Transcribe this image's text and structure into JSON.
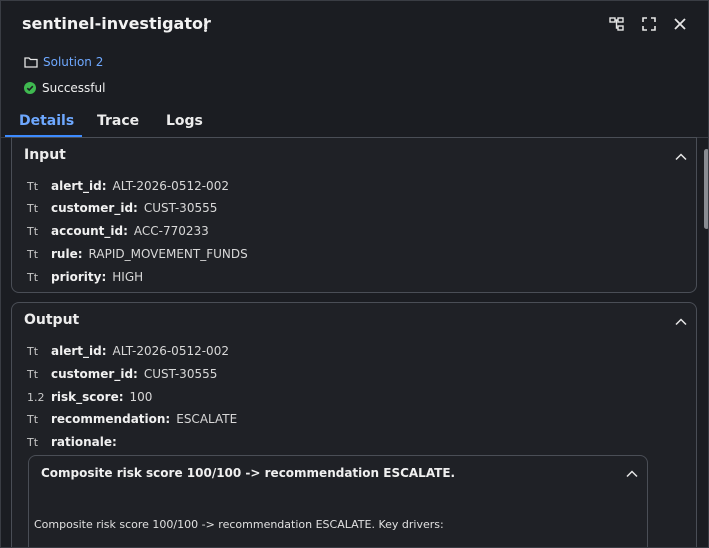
{
  "header": {
    "title": "sentinel-investigator"
  },
  "solution": {
    "label": "Solution 2"
  },
  "status": {
    "label": "Successful",
    "color": "#3fb950"
  },
  "tabs": [
    {
      "label": "Details",
      "active": true
    },
    {
      "label": "Trace",
      "active": false
    },
    {
      "label": "Logs",
      "active": false
    }
  ],
  "input": {
    "title": "Input",
    "fields": [
      {
        "type": "Tt",
        "key": "alert_id:",
        "value": "ALT-2026-0512-002"
      },
      {
        "type": "Tt",
        "key": "customer_id:",
        "value": "CUST-30555"
      },
      {
        "type": "Tt",
        "key": "account_id:",
        "value": "ACC-770233"
      },
      {
        "type": "Tt",
        "key": "rule:",
        "value": "RAPID_MOVEMENT_FUNDS"
      },
      {
        "type": "Tt",
        "key": "priority:",
        "value": "HIGH"
      }
    ]
  },
  "output": {
    "title": "Output",
    "fields": [
      {
        "type": "Tt",
        "key": "alert_id:",
        "value": "ALT-2026-0512-002"
      },
      {
        "type": "Tt",
        "key": "customer_id:",
        "value": "CUST-30555"
      },
      {
        "type": "1.2",
        "key": "risk_score:",
        "value": "100"
      },
      {
        "type": "Tt",
        "key": "recommendation:",
        "value": "ESCALATE"
      },
      {
        "type": "Tt",
        "key": "rationale:",
        "value": ""
      }
    ],
    "rationale": {
      "title": "Composite risk score 100/100 -> recommendation ESCALATE.",
      "body": "Composite risk score 100/100 -> recommendation ESCALATE. Key drivers:"
    }
  },
  "colors": {
    "accent": "#3d8bff",
    "link": "#6ea8ff",
    "background": "#1b1d22"
  }
}
